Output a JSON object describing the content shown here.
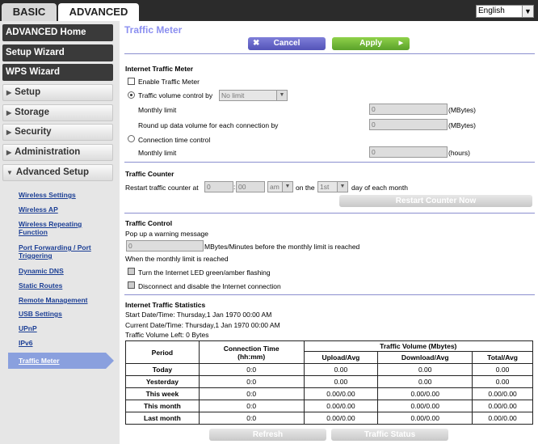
{
  "tabs": {
    "basic": "BASIC",
    "advanced": "ADVANCED"
  },
  "language": {
    "selected": "English"
  },
  "sidebar": {
    "advanced_home": "ADVANCED Home",
    "setup_wizard": "Setup Wizard",
    "wps_wizard": "WPS Wizard",
    "sections": [
      "Setup",
      "Storage",
      "Security",
      "Administration"
    ],
    "advanced_setup": "Advanced Setup",
    "links": [
      "Wireless Settings",
      "Wireless AP",
      "Wireless Repeating Function",
      "Port Forwarding / Port Triggering",
      "Dynamic DNS",
      "Static Routes",
      "Remote Management",
      "USB Settings",
      "UPnP",
      "IPv6"
    ],
    "active": "Traffic Meter"
  },
  "page": {
    "title": "Traffic Meter",
    "cancel": "Cancel",
    "apply": "Apply"
  },
  "meter": {
    "heading": "Internet Traffic Meter",
    "enable_label": "Enable Traffic Meter",
    "volume_label": "Traffic volume control by",
    "volume_value": "No limit",
    "monthly_limit_label": "Monthly limit",
    "monthly_limit_value": "0",
    "mbytes": "(MBytes)",
    "roundup_label": "Round up data volume for each connection by",
    "roundup_value": "0",
    "conn_time_label": "Connection time control",
    "monthly_limit2_label": "Monthly limit",
    "monthly_limit2_value": "0",
    "hours": "(hours)"
  },
  "counter": {
    "heading": "Traffic Counter",
    "restart_label": "Restart traffic counter at",
    "hour": "0",
    "minute": "00",
    "ampm": "am",
    "on_the": "on the",
    "day": "1st",
    "day_suffix": "day of each month",
    "restart_btn": "Restart Counter Now"
  },
  "control": {
    "heading": "Traffic Control",
    "popup_label": "Pop up a warning message",
    "popup_value": "0",
    "popup_suffix": "MBytes/Minutes before the monthly limit is reached",
    "when_label": "When the monthly limit is reached",
    "led_label": "Turn the Internet LED green/amber flashing",
    "disconnect_label": "Disconnect and disable the Internet connection"
  },
  "stats": {
    "heading": "Internet Traffic Statistics",
    "start": "Start Date/Time: Thursday,1 Jan 1970 00:00 AM",
    "current": "Current Date/Time: Thursday,1 Jan 1970 00:00 AM",
    "left": "Traffic Volume Left: 0 Bytes",
    "headers": {
      "period": "Period",
      "conn_time": "Connection Time",
      "conn_time_unit": "(hh:mm)",
      "volume": "Traffic Volume (Mbytes)",
      "upload": "Upload/Avg",
      "download": "Download/Avg",
      "total": "Total/Avg"
    },
    "rows": [
      {
        "period": "Today",
        "time": "0:0",
        "upload": "0.00",
        "download": "0.00",
        "total": "0.00"
      },
      {
        "period": "Yesterday",
        "time": "0:0",
        "upload": "0.00",
        "download": "0.00",
        "total": "0.00"
      },
      {
        "period": "This week",
        "time": "0:0",
        "upload": "0.00/0.00",
        "download": "0.00/0.00",
        "total": "0.00/0.00"
      },
      {
        "period": "This month",
        "time": "0:0",
        "upload": "0.00/0.00",
        "download": "0.00/0.00",
        "total": "0.00/0.00"
      },
      {
        "period": "Last month",
        "time": "0:0",
        "upload": "0.00/0.00",
        "download": "0.00/0.00",
        "total": "0.00/0.00"
      }
    ],
    "refresh": "Refresh",
    "traffic_status": "Traffic Status"
  }
}
